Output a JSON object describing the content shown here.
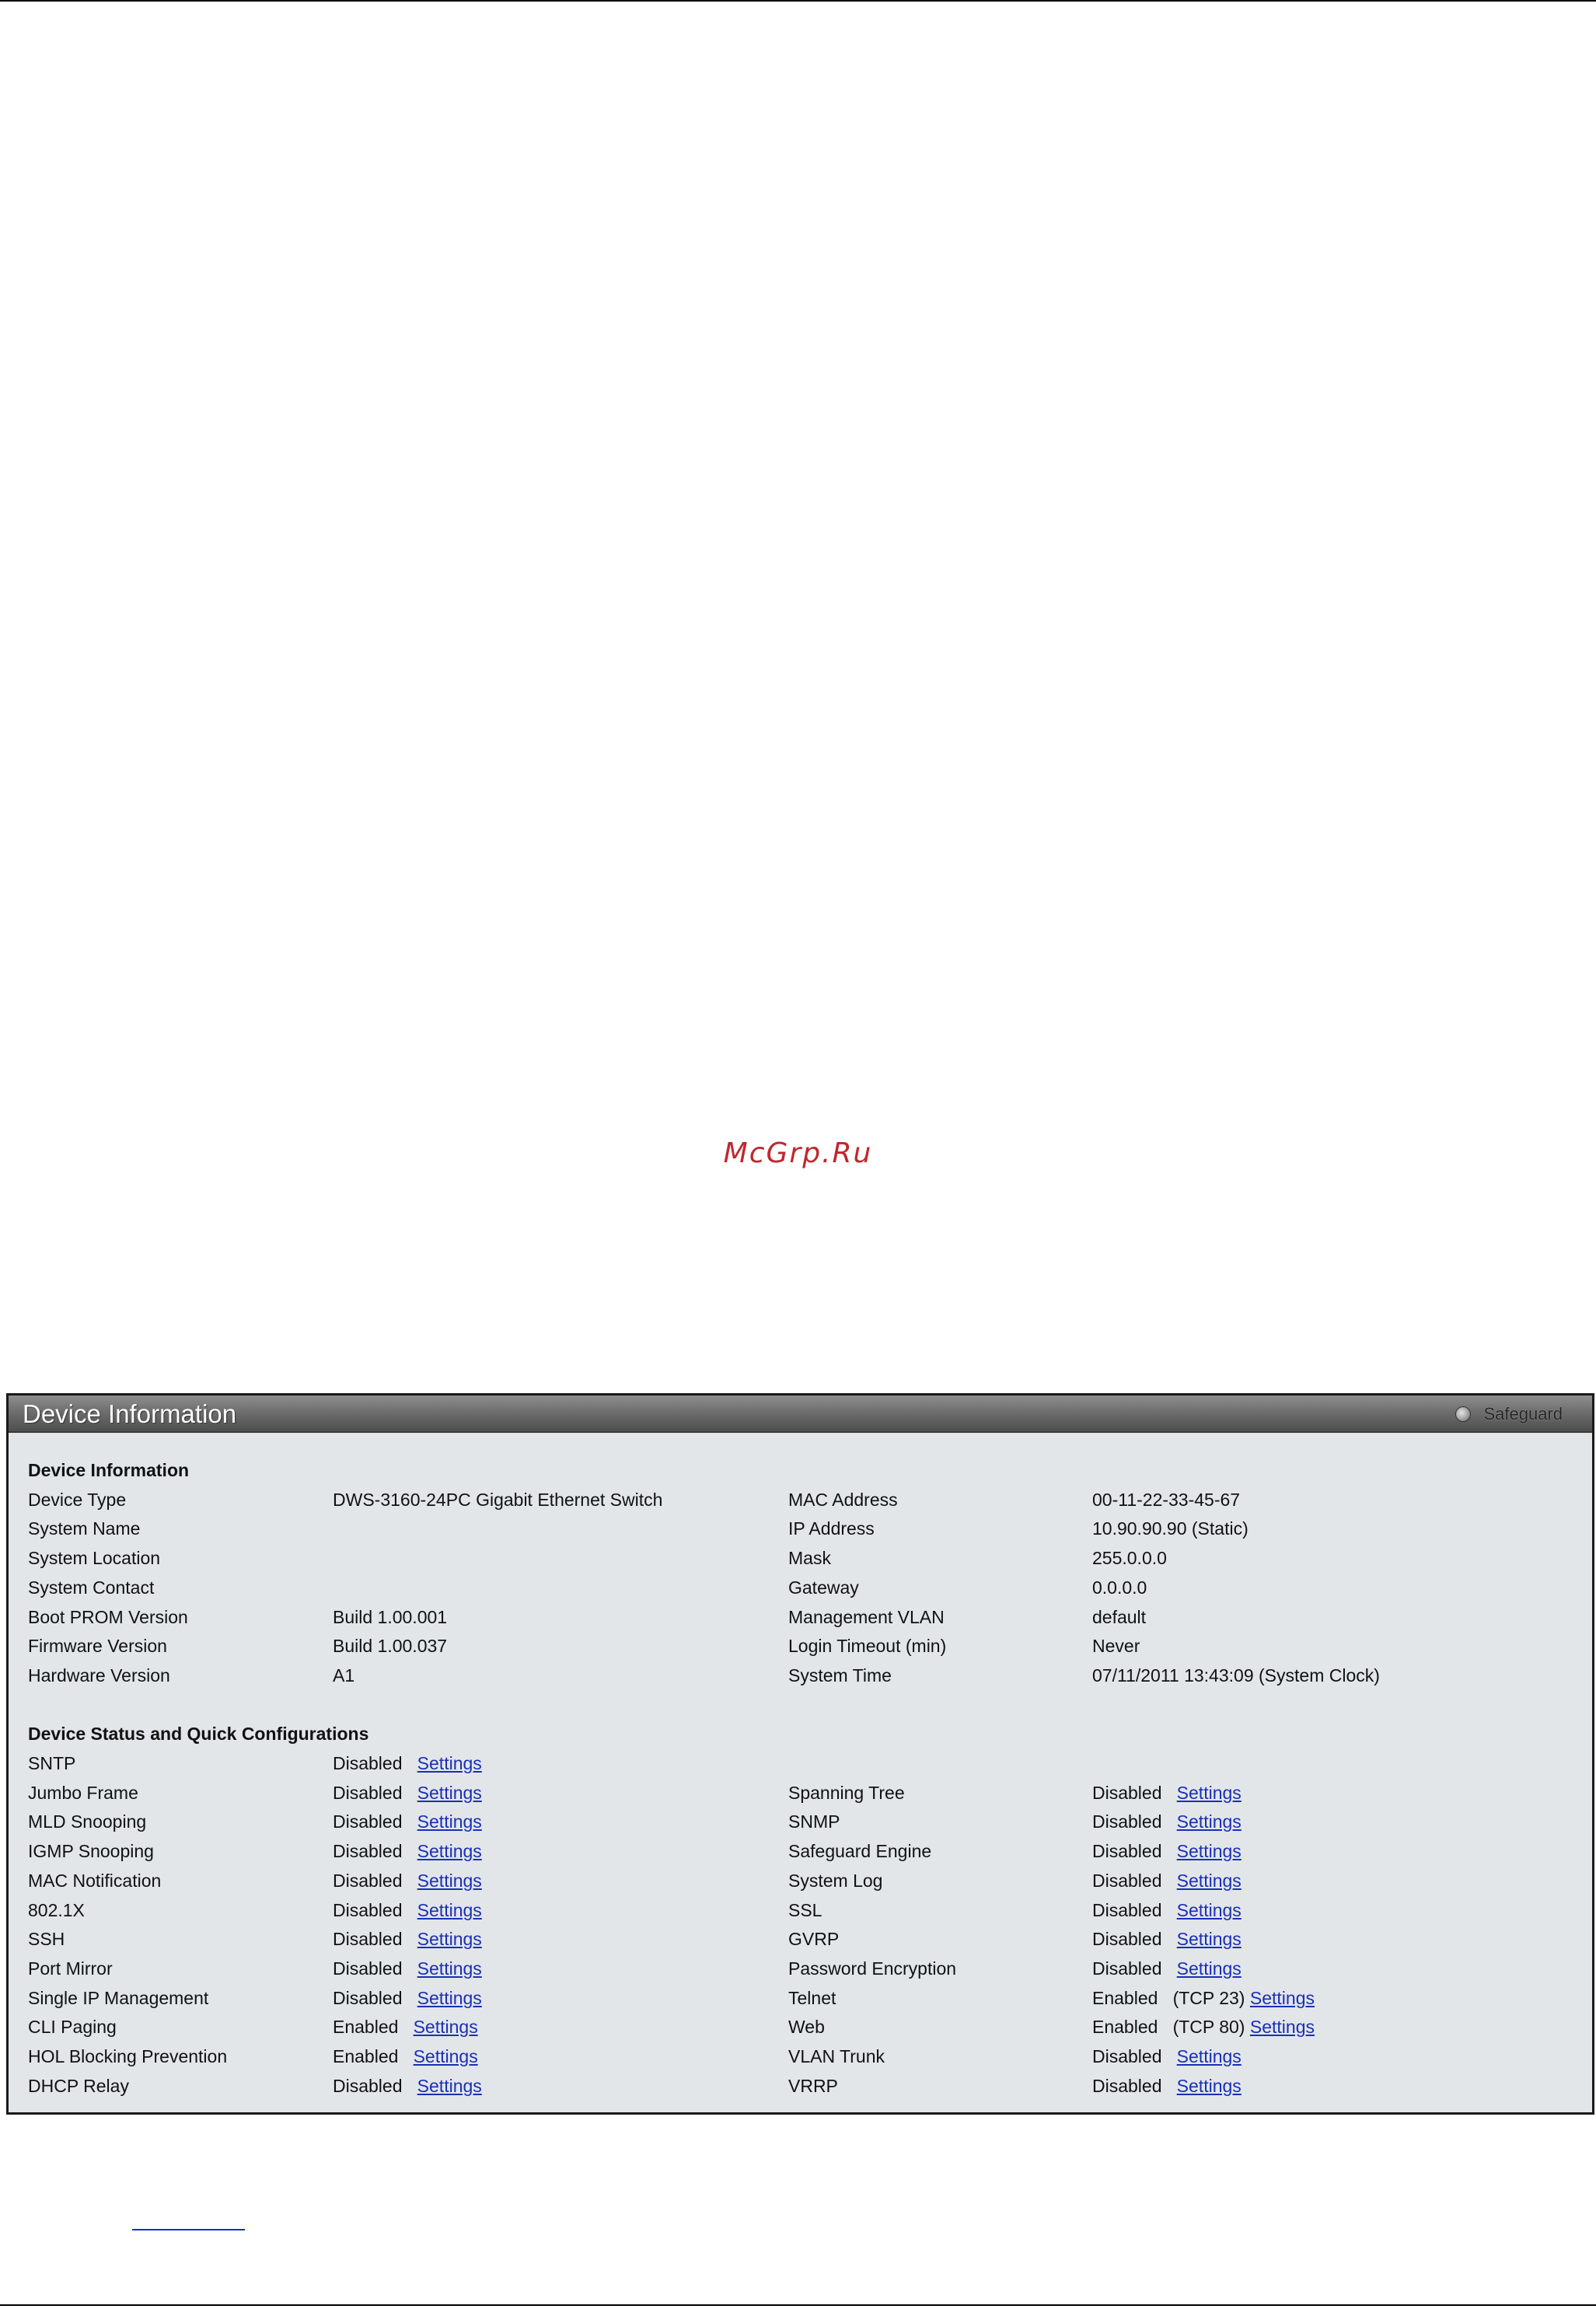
{
  "watermark": "McGrp.Ru",
  "panel": {
    "title": "Device Information",
    "safeguard_label": "Safeguard"
  },
  "device_info": {
    "heading": "Device Information",
    "left": [
      {
        "label": "Device Type",
        "value": "DWS-3160-24PC Gigabit Ethernet Switch"
      },
      {
        "label": "System Name",
        "value": ""
      },
      {
        "label": "System Location",
        "value": ""
      },
      {
        "label": "System Contact",
        "value": ""
      },
      {
        "label": "Boot PROM Version",
        "value": "Build 1.00.001"
      },
      {
        "label": "Firmware Version",
        "value": "Build 1.00.037"
      },
      {
        "label": "Hardware Version",
        "value": "A1"
      }
    ],
    "right": [
      {
        "label": "MAC Address",
        "value": "00-11-22-33-45-67"
      },
      {
        "label": "IP Address",
        "value": "10.90.90.90 (Static)"
      },
      {
        "label": "Mask",
        "value": "255.0.0.0"
      },
      {
        "label": "Gateway",
        "value": "0.0.0.0"
      },
      {
        "label": "Management VLAN",
        "value": "default"
      },
      {
        "label": "Login Timeout (min)",
        "value": "Never"
      },
      {
        "label": "System Time",
        "value": "07/11/2011 13:43:09 (System Clock)"
      }
    ]
  },
  "status": {
    "heading": "Device Status and Quick Configurations",
    "link_label": "Settings",
    "left": [
      {
        "label": "SNTP",
        "value": "Disabled",
        "extra": ""
      },
      {
        "label": "Jumbo Frame",
        "value": "Disabled",
        "extra": ""
      },
      {
        "label": "MLD Snooping",
        "value": "Disabled",
        "extra": ""
      },
      {
        "label": "IGMP Snooping",
        "value": "Disabled",
        "extra": ""
      },
      {
        "label": "MAC Notification",
        "value": "Disabled",
        "extra": ""
      },
      {
        "label": "802.1X",
        "value": "Disabled",
        "extra": ""
      },
      {
        "label": "SSH",
        "value": "Disabled",
        "extra": ""
      },
      {
        "label": "Port Mirror",
        "value": "Disabled",
        "extra": ""
      },
      {
        "label": "Single IP Management",
        "value": "Disabled",
        "extra": ""
      },
      {
        "label": "CLI Paging",
        "value": "Enabled",
        "extra": ""
      },
      {
        "label": "HOL Blocking Prevention",
        "value": "Enabled",
        "extra": ""
      },
      {
        "label": "DHCP Relay",
        "value": "Disabled",
        "extra": ""
      }
    ],
    "right": [
      {
        "label": "Spanning Tree",
        "value": "Disabled",
        "extra": ""
      },
      {
        "label": "SNMP",
        "value": "Disabled",
        "extra": ""
      },
      {
        "label": "Safeguard Engine",
        "value": "Disabled",
        "extra": ""
      },
      {
        "label": "System Log",
        "value": "Disabled",
        "extra": ""
      },
      {
        "label": "SSL",
        "value": "Disabled",
        "extra": ""
      },
      {
        "label": "GVRP",
        "value": "Disabled",
        "extra": ""
      },
      {
        "label": "Password Encryption",
        "value": "Disabled",
        "extra": ""
      },
      {
        "label": "Telnet",
        "value": "Enabled",
        "extra": "(TCP 23)"
      },
      {
        "label": "Web",
        "value": "Enabled",
        "extra": "(TCP 80)"
      },
      {
        "label": "VLAN Trunk",
        "value": "Disabled",
        "extra": ""
      },
      {
        "label": "VRRP",
        "value": "Disabled",
        "extra": ""
      }
    ]
  }
}
